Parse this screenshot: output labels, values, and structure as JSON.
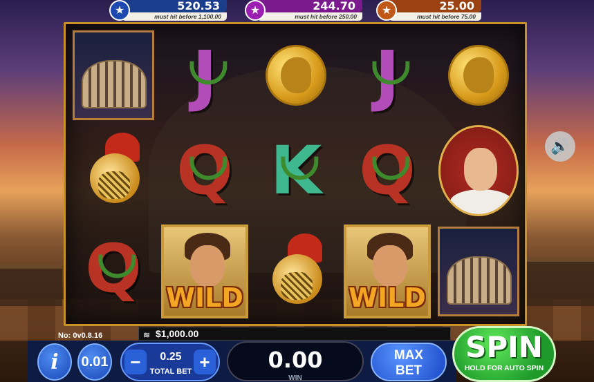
{
  "jackpots": [
    {
      "amount": "520.53",
      "note": "must hit before 1,100.00",
      "icon": "star-icon",
      "color": "#1d48b0"
    },
    {
      "amount": "244.70",
      "note": "must hit before 250.00",
      "icon": "star-icon",
      "color": "#9b1fb0"
    },
    {
      "amount": "25.00",
      "note": "must hit before 75.00",
      "icon": "star-icon",
      "color": "#c05818"
    }
  ],
  "reels": {
    "wild_label": "WILD",
    "letters": {
      "j": "J",
      "q": "Q",
      "k": "K"
    },
    "grid": [
      [
        "colosseum",
        "gladiator-helmet",
        "queen"
      ],
      [
        "jack",
        "queen",
        "wild-gladiator"
      ],
      [
        "gold-coin",
        "king",
        "gladiator-helmet"
      ],
      [
        "jack",
        "queen",
        "wild-gladiator"
      ],
      [
        "gold-coin",
        "caesar",
        "colosseum"
      ]
    ]
  },
  "version": "No: 0v0.8.16",
  "balance": "$1,000.00",
  "controls": {
    "info_label": "i",
    "denomination": "0.01",
    "minus": "−",
    "plus": "+",
    "total_bet": "0.25",
    "total_bet_label": "TOTAL BET",
    "win": "0.00",
    "win_label": "WIN",
    "max_bet_line1": "MAX",
    "max_bet_line2": "BET",
    "spin": "SPIN",
    "spin_sub": "HOLD FOR AUTO SPIN"
  },
  "sound_icon": "speaker-icon"
}
